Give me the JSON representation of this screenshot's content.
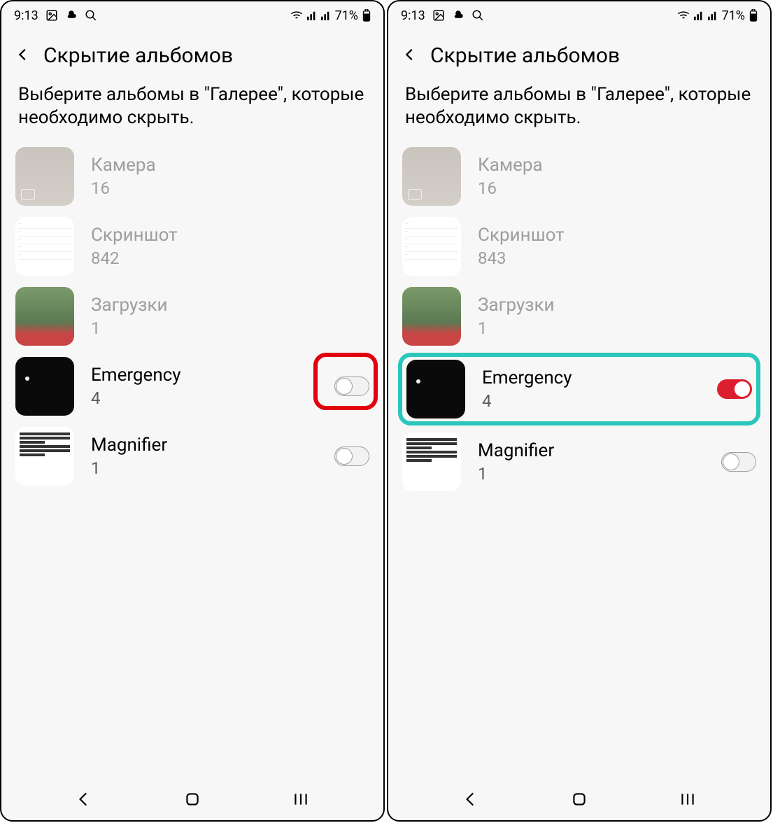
{
  "status": {
    "time": "9:13",
    "battery": "71%"
  },
  "header": {
    "title": "Скрытие альбомов"
  },
  "desc": "Выберите альбомы в \"Галерее\", которые необходимо скрыть.",
  "left": {
    "albums": [
      {
        "name": "Камера",
        "count": "16",
        "kind": "camera",
        "toggle": null
      },
      {
        "name": "Скриншот",
        "count": "842",
        "kind": "screenshot",
        "toggle": null
      },
      {
        "name": "Загрузки",
        "count": "1",
        "kind": "downloads",
        "toggle": null
      },
      {
        "name": "Emergency",
        "count": "4",
        "kind": "emergency",
        "toggle": "off"
      },
      {
        "name": "Magnifier",
        "count": "1",
        "kind": "magnifier",
        "toggle": "off"
      }
    ],
    "highlight": {
      "index": 3,
      "shape": "toggle-red"
    }
  },
  "right": {
    "albums": [
      {
        "name": "Камера",
        "count": "16",
        "kind": "camera",
        "toggle": null
      },
      {
        "name": "Скриншот",
        "count": "843",
        "kind": "screenshot",
        "toggle": null
      },
      {
        "name": "Загрузки",
        "count": "1",
        "kind": "downloads",
        "toggle": null
      },
      {
        "name": "Emergency",
        "count": "4",
        "kind": "emergency",
        "toggle": "on"
      },
      {
        "name": "Magnifier",
        "count": "1",
        "kind": "magnifier",
        "toggle": "off"
      }
    ],
    "highlight": {
      "index": 3,
      "shape": "row-teal"
    }
  },
  "colors": {
    "accent_red": "#db1f2e",
    "highlight_red": "#e2000f",
    "highlight_teal": "#2bc6bc"
  }
}
